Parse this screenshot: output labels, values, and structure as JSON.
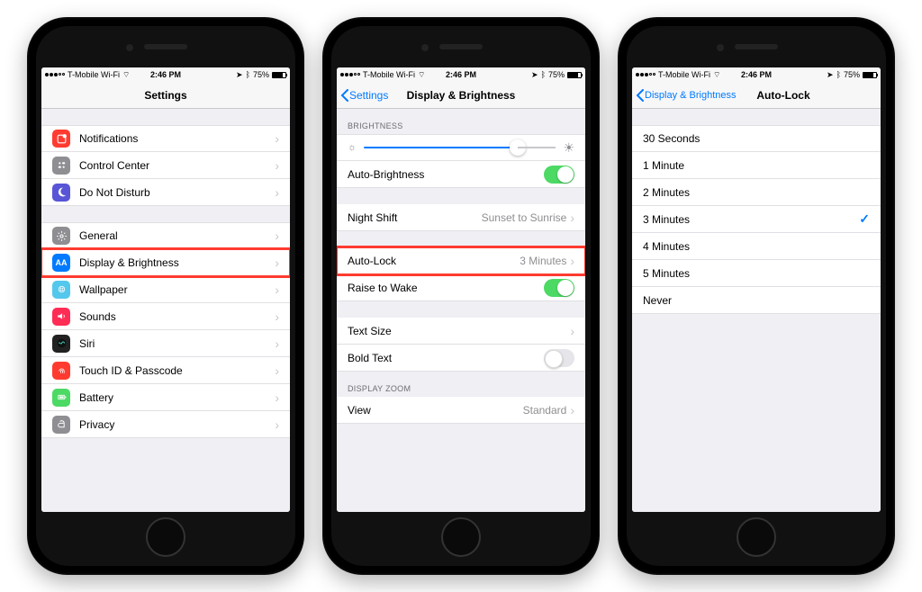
{
  "status": {
    "carrier": "T-Mobile Wi-Fi",
    "time": "2:46 PM",
    "battery_pct": "75%"
  },
  "phone1": {
    "title": "Settings",
    "groups": [
      [
        {
          "icon": "notifications",
          "color": "#ff3b30",
          "label": "Notifications"
        },
        {
          "icon": "control-center",
          "color": "#8e8e93",
          "label": "Control Center"
        },
        {
          "icon": "do-not-disturb",
          "color": "#5856d6",
          "label": "Do Not Disturb"
        }
      ],
      [
        {
          "icon": "general",
          "color": "#8e8e93",
          "label": "General"
        },
        {
          "icon": "display",
          "color": "#007aff",
          "label": "Display & Brightness",
          "highlight": true
        },
        {
          "icon": "wallpaper",
          "color": "#54c7ec",
          "label": "Wallpaper"
        },
        {
          "icon": "sounds",
          "color": "#ff2d55",
          "label": "Sounds"
        },
        {
          "icon": "siri",
          "color": "#222",
          "label": "Siri"
        },
        {
          "icon": "touch-id",
          "color": "#ff3b30",
          "label": "Touch ID & Passcode"
        },
        {
          "icon": "battery",
          "color": "#4cd964",
          "label": "Battery"
        },
        {
          "icon": "privacy",
          "color": "#8e8e93",
          "label": "Privacy"
        }
      ]
    ]
  },
  "phone2": {
    "back": "Settings",
    "title": "Display & Brightness",
    "section_brightness": "BRIGHTNESS",
    "auto_brightness": "Auto-Brightness",
    "night_shift": "Night Shift",
    "night_shift_value": "Sunset to Sunrise",
    "auto_lock": "Auto-Lock",
    "auto_lock_value": "3 Minutes",
    "raise_to_wake": "Raise to Wake",
    "text_size": "Text Size",
    "bold_text": "Bold Text",
    "section_zoom": "DISPLAY ZOOM",
    "view": "View",
    "view_value": "Standard"
  },
  "phone3": {
    "back": "Display & Brightness",
    "title": "Auto-Lock",
    "options": [
      {
        "label": "30 Seconds",
        "selected": false
      },
      {
        "label": "1 Minute",
        "selected": false
      },
      {
        "label": "2 Minutes",
        "selected": false
      },
      {
        "label": "3 Minutes",
        "selected": true
      },
      {
        "label": "4 Minutes",
        "selected": false
      },
      {
        "label": "5 Minutes",
        "selected": false
      },
      {
        "label": "Never",
        "selected": false
      }
    ]
  }
}
